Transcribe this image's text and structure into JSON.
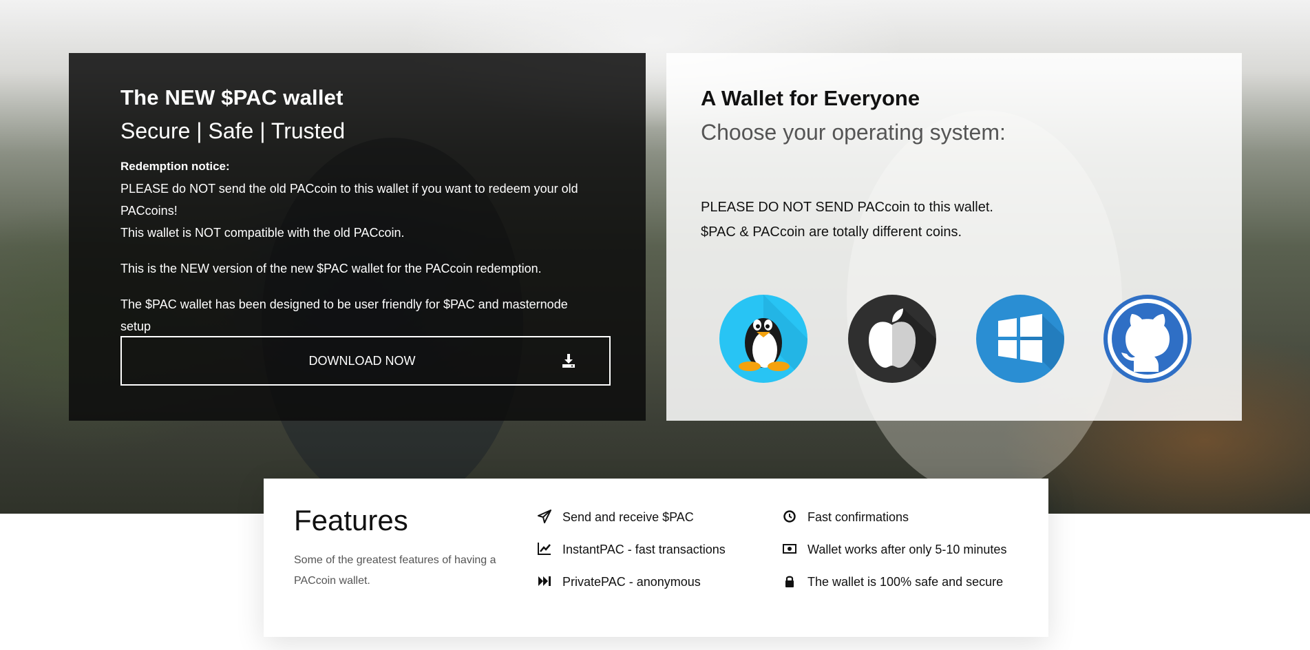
{
  "hero": {
    "left_card": {
      "title": "The NEW $PAC wallet",
      "subtitle": "Secure | Safe | Trusted",
      "notice_title": "Redemption notice:",
      "notice_line1": "PLEASE do NOT send the old PACcoin to this wallet if you want to redeem your old PACcoins!",
      "notice_line2": "This wallet is NOT compatible with the old PACcoin.",
      "paragraph1": "This is the NEW version of the new $PAC wallet for the PACcoin redemption.",
      "paragraph2": "The $PAC wallet has been designed to be user friendly for $PAC and masternode setup",
      "download_label": "DOWNLOAD NOW",
      "download_icon": "download-icon"
    },
    "right_card": {
      "title": "A Wallet for Everyone",
      "subtitle": "Choose your operating system:",
      "warning_line1": "PLEASE DO NOT SEND PACcoin to this wallet.",
      "warning_line2": "$PAC & PACcoin are totally different coins.",
      "os_icons": [
        "linux-icon",
        "apple-icon",
        "windows-icon",
        "github-icon"
      ]
    }
  },
  "features": {
    "title": "Features",
    "description": "Some of the greatest features of having a PACcoin wallet.",
    "column1": [
      {
        "icon": "paper-plane-icon",
        "label": "Send and receive $PAC"
      },
      {
        "icon": "chart-line-icon",
        "label": "InstantPAC - fast transactions"
      },
      {
        "icon": "fast-forward-icon",
        "label": "PrivatePAC - anonymous"
      }
    ],
    "column2": [
      {
        "icon": "clock-icon",
        "label": "Fast confirmations"
      },
      {
        "icon": "money-bill-icon",
        "label": "Wallet works after only 5-10 minutes"
      },
      {
        "icon": "lock-icon",
        "label": "The wallet is 100% safe and secure"
      }
    ]
  },
  "colors": {
    "dark_card": "#0c0c0c",
    "light_card": "#ffffff",
    "linux_bg": "#28c4f4",
    "apple_bg": "#2f2f2f",
    "windows_bg": "#2a8ed3",
    "github_bg": "#2f6fc5"
  }
}
